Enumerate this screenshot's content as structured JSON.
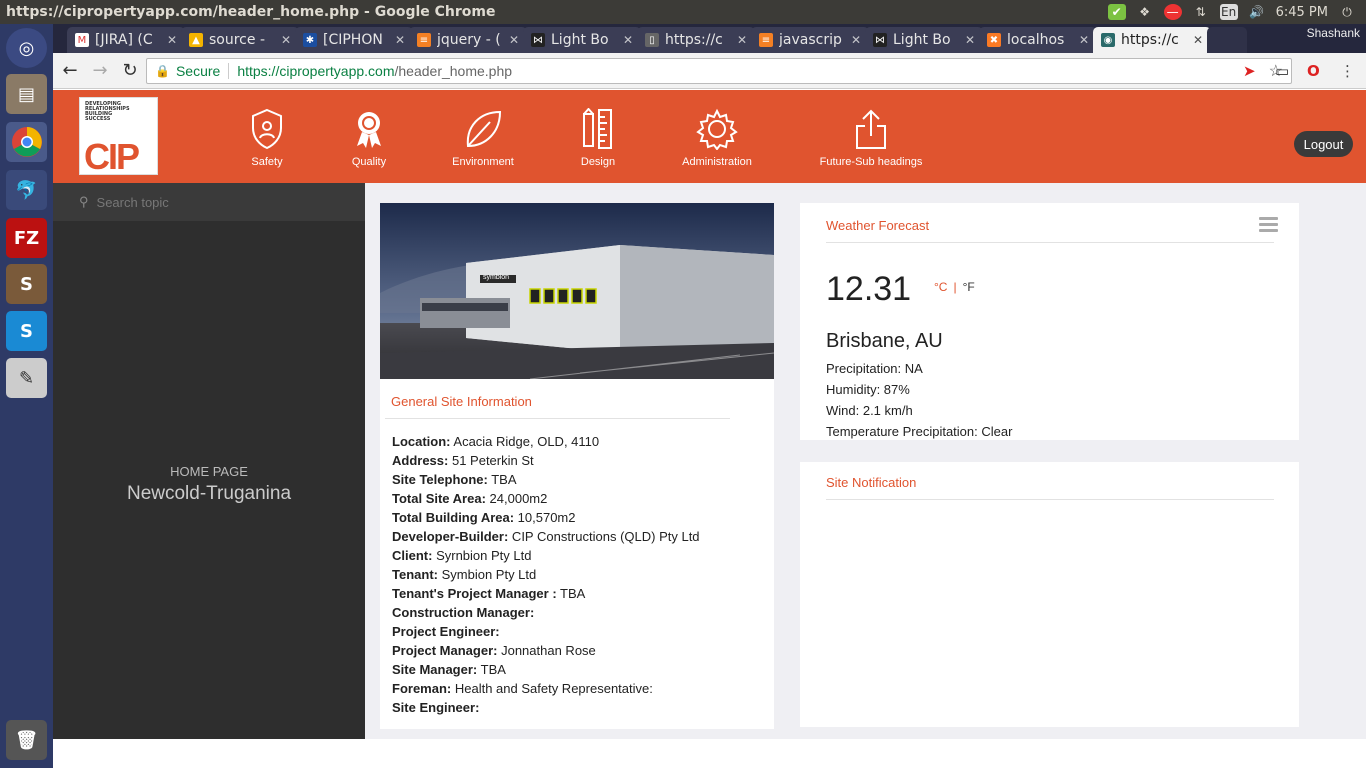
{
  "os": {
    "window_title": "https://cipropertyapp.com/header_home.php - Google Chrome",
    "keyboard": "En",
    "time": "6:45 PM"
  },
  "browser": {
    "tabs": [
      {
        "label": "[JIRA] (C",
        "icon": "gmail-icon"
      },
      {
        "label": "source -",
        "icon": "drive-icon"
      },
      {
        "label": "[CIPHON",
        "icon": "jira-icon"
      },
      {
        "label": "jquery - (",
        "icon": "stackoverflow-icon"
      },
      {
        "label": "Light Bo",
        "icon": "lightbox-icon"
      },
      {
        "label": "https://c",
        "icon": "page-icon"
      },
      {
        "label": "javascrip",
        "icon": "stackoverflow-icon"
      },
      {
        "label": "Light Bo",
        "icon": "lightbox-icon"
      },
      {
        "label": "localhos",
        "icon": "xampp-icon"
      },
      {
        "label": "https://c",
        "icon": "site-icon",
        "active": true
      }
    ],
    "profile_name": "Shashank",
    "secure_label": "Secure",
    "url_host": "https://cipropertyapp.com",
    "url_path": "/header_home.php"
  },
  "site": {
    "logo": {
      "tagline": [
        "DEVELOPING",
        "RELATIONSHIPS",
        "BUILDING",
        "SUCCESS"
      ],
      "wordmark": "CIP"
    },
    "menu": [
      {
        "label": "Safety",
        "icon": "shield-user-icon"
      },
      {
        "label": "Quality",
        "icon": "award-ribbon-icon"
      },
      {
        "label": "Environment",
        "icon": "leaf-icon"
      },
      {
        "label": "Design",
        "icon": "pencil-ruler-icon"
      },
      {
        "label": "Administration",
        "icon": "gear-icon"
      },
      {
        "label": "Future-Sub headings",
        "icon": "share-upload-icon"
      }
    ],
    "logout_label": "Logout",
    "search_placeholder": "Search topic",
    "home_label": "HOME PAGE",
    "site_name": "Newcold-Truganina",
    "general_info": {
      "title": "General Site Information",
      "image_sign": "symbion",
      "rows": [
        {
          "label": "Location:",
          "value": " Acacia Ridge, OLD, 4110"
        },
        {
          "label": "Address:",
          "value": " 51 Peterkin St"
        },
        {
          "label": "Site Telephone:",
          "value": " TBA"
        },
        {
          "label": "Total Site Area:",
          "value": " 24,000m2"
        },
        {
          "label": "Total Building Area:",
          "value": " 10,570m2"
        },
        {
          "label": "Developer-Builder:",
          "value": " CIP Constructions (QLD) Pty Ltd"
        },
        {
          "label": "Client:",
          "value": " Syrnbion Pty Ltd"
        },
        {
          "label": "Tenant:",
          "value": " Symbion Pty Ltd"
        },
        {
          "label": "Tenant's Project Manager :",
          "value": " TBA"
        },
        {
          "label": "Construction Manager:",
          "value": ""
        },
        {
          "label": "Project Engineer:",
          "value": ""
        },
        {
          "label": "Project Manager:",
          "value": " Jonnathan Rose"
        },
        {
          "label": "Site Manager:",
          "value": " TBA"
        },
        {
          "label": "Foreman:",
          "value": " Health and Safety Representative:"
        },
        {
          "label": "Site Engineer:",
          "value": ""
        }
      ]
    },
    "weather": {
      "title": "Weather Forecast",
      "temperature": "12.31",
      "unit_c": "°C",
      "unit_f": "°F",
      "city": "Brisbane, AU",
      "details": [
        "Precipitation: NA",
        "Humidity: 87%",
        "Wind: 2.1 km/h",
        "Temperature Precipitation: Clear"
      ]
    },
    "notification": {
      "title": "Site Notification"
    },
    "colors": {
      "brand": "#e0542f",
      "sidebar": "#2e2e2e"
    }
  }
}
